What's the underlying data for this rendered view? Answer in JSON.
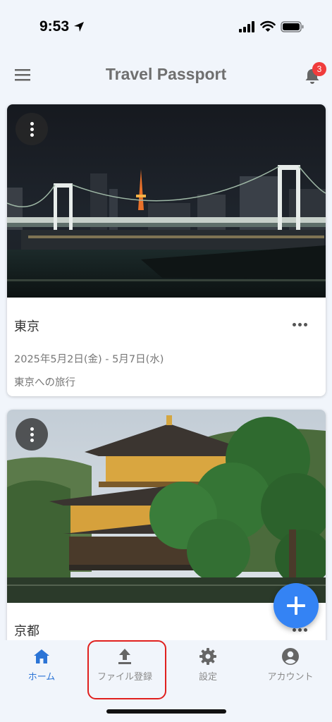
{
  "status_bar": {
    "time": "9:53",
    "icons": [
      "location-arrow-icon",
      "cellular-signal-icon",
      "wifi-icon",
      "battery-icon"
    ]
  },
  "header": {
    "title": "Travel Passport",
    "menu_icon": "menu-icon",
    "notification_icon": "bell-icon",
    "notification_count": "3"
  },
  "cards": [
    {
      "image": "photo of Tokyo Rainbow Bridge at night with Tokyo Tower",
      "title": "東京",
      "dates": "2025年5月2日(金) - 5月7日(水)",
      "description": "東京への旅行"
    },
    {
      "image": "photo of Kinkaku-ji golden pavilion with pine trees",
      "title": "京都"
    }
  ],
  "fab": {
    "icon": "plus-icon"
  },
  "bottom_nav": {
    "items": [
      {
        "label": "ホーム",
        "icon": "home-icon",
        "active": true
      },
      {
        "label": "ファイル登録",
        "icon": "upload-icon",
        "active": false
      },
      {
        "label": "設定",
        "icon": "gear-icon",
        "active": false
      },
      {
        "label": "アカウント",
        "icon": "account-circle-icon",
        "active": false
      }
    ]
  },
  "colors": {
    "background": "#f1f5fb",
    "accent": "#3483f4",
    "active_nav": "#2b74d6",
    "badge": "#f03c3c",
    "highlight": "#e0201e"
  }
}
